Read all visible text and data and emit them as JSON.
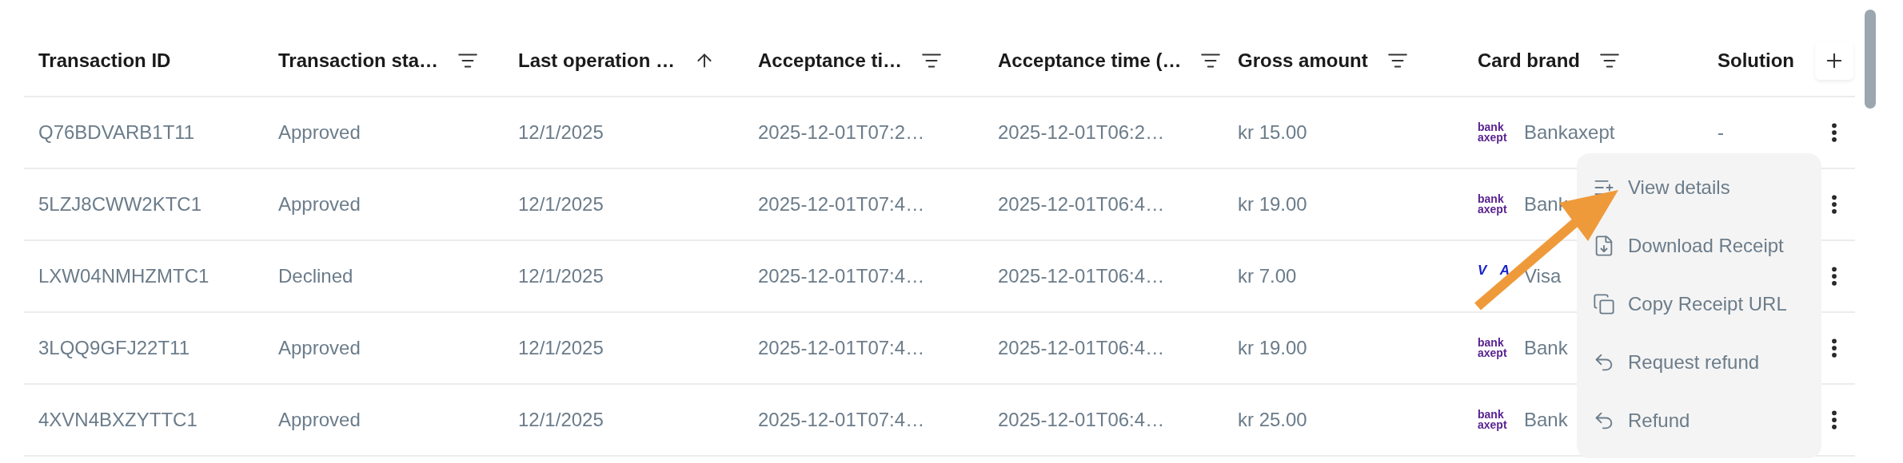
{
  "table": {
    "columns": [
      {
        "label": "Transaction ID"
      },
      {
        "label": "Transaction sta…",
        "kind": "filter"
      },
      {
        "label": "Last operation …",
        "kind": "sort_asc"
      },
      {
        "label": "Acceptance ti…",
        "kind": "filter"
      },
      {
        "label": "Acceptance time (…",
        "kind": "filter"
      },
      {
        "label": "Gross amount",
        "kind": "filter"
      },
      {
        "label": "Card brand",
        "kind": "filter"
      },
      {
        "label": "Solution"
      }
    ],
    "rows": [
      {
        "cells": [
          "Q76BDVARB1T11",
          "Approved",
          "12/1/2025",
          "2025-12-01T07:2…",
          "2025-12-01T06:2…",
          "kr 15.00"
        ],
        "card_brand": {
          "kind": "bankaxept",
          "logo": [
            "bank",
            "axept"
          ],
          "name": "Bankaxept"
        },
        "solution": "-"
      },
      {
        "cells": [
          "5LZJ8CWW2KTC1",
          "Approved",
          "12/1/2025",
          "2025-12-01T07:4…",
          "2025-12-01T06:4…",
          "kr 19.00"
        ],
        "card_brand": {
          "kind": "bankaxept",
          "logo": [
            "bank",
            "axept"
          ],
          "name": "Bank"
        }
      },
      {
        "cells": [
          "LXW04NMHZMTC1",
          "Declined",
          "12/1/2025",
          "2025-12-01T07:4…",
          "2025-12-01T06:4…",
          "kr 7.00"
        ],
        "card_brand": {
          "kind": "visa",
          "logo": [
            "V",
            "A"
          ],
          "name": "Visa"
        }
      },
      {
        "cells": [
          "3LQQ9GFJ22T11",
          "Approved",
          "12/1/2025",
          "2025-12-01T07:4…",
          "2025-12-01T06:4…",
          "kr 19.00"
        ],
        "card_brand": {
          "kind": "bankaxept",
          "logo": [
            "bank",
            "axept"
          ],
          "name": "Bank"
        }
      },
      {
        "cells": [
          "4XVN4BXZYTTC1",
          "Approved",
          "12/1/2025",
          "2025-12-01T07:4…",
          "2025-12-01T06:4…",
          "kr 25.00"
        ],
        "card_brand": {
          "kind": "bankaxept",
          "logo": [
            "bank",
            "axept"
          ],
          "name": "Bank"
        }
      }
    ]
  },
  "context_menu": {
    "items": [
      {
        "label": "View details",
        "kind": "details"
      },
      {
        "label": "Download Receipt",
        "kind": "download"
      },
      {
        "label": "Copy Receipt URL",
        "kind": "copy"
      },
      {
        "label": "Request refund",
        "kind": "undo"
      },
      {
        "label": "Refund",
        "kind": "undo"
      }
    ]
  }
}
